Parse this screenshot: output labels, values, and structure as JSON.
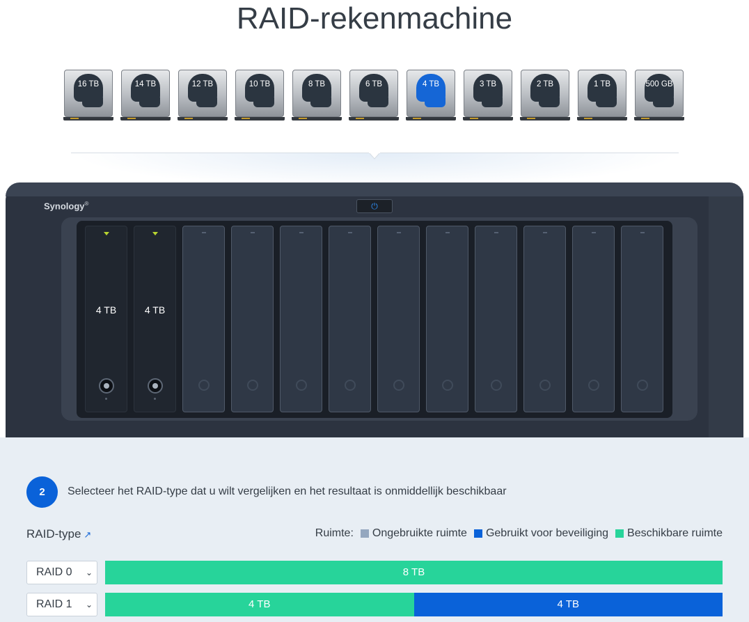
{
  "page": {
    "title": "RAID-rekenmachine"
  },
  "drive_picker": {
    "drives": [
      {
        "label": "16 TB",
        "selected": false
      },
      {
        "label": "14 TB",
        "selected": false
      },
      {
        "label": "12 TB",
        "selected": false
      },
      {
        "label": "10 TB",
        "selected": false
      },
      {
        "label": "8 TB",
        "selected": false
      },
      {
        "label": "6 TB",
        "selected": false
      },
      {
        "label": "4 TB",
        "selected": true
      },
      {
        "label": "3 TB",
        "selected": false
      },
      {
        "label": "2 TB",
        "selected": false
      },
      {
        "label": "1 TB",
        "selected": false
      },
      {
        "label": "500 GB",
        "selected": false
      }
    ]
  },
  "nas": {
    "brand": "Synology",
    "brand_mark": "®",
    "power_icon": "power-icon",
    "slots": [
      {
        "filled": true,
        "capacity": "4 TB"
      },
      {
        "filled": true,
        "capacity": "4 TB"
      },
      {
        "filled": false,
        "capacity": ""
      },
      {
        "filled": false,
        "capacity": ""
      },
      {
        "filled": false,
        "capacity": ""
      },
      {
        "filled": false,
        "capacity": ""
      },
      {
        "filled": false,
        "capacity": ""
      },
      {
        "filled": false,
        "capacity": ""
      },
      {
        "filled": false,
        "capacity": ""
      },
      {
        "filled": false,
        "capacity": ""
      },
      {
        "filled": false,
        "capacity": ""
      },
      {
        "filled": false,
        "capacity": ""
      }
    ]
  },
  "step2": {
    "number": "2",
    "text": "Selecteer het RAID-type dat u wilt vergelijken en het resultaat is onmiddellijk beschikbaar"
  },
  "raid_type": {
    "label": "RAID-type",
    "link_icon": "external-link-icon"
  },
  "legend": {
    "title": "Ruimte:",
    "items": [
      {
        "label": "Ongebruikte ruimte",
        "color": "#94a7bf"
      },
      {
        "label": "Gebruikt voor beveiliging",
        "color": "#0a62d9"
      },
      {
        "label": "Beschikbare ruimte",
        "color": "#27d49a"
      }
    ]
  },
  "raid_rows": [
    {
      "selected": "RAID 0",
      "segments": [
        {
          "label": "8 TB",
          "kind": "available",
          "share": 1.0
        }
      ]
    },
    {
      "selected": "RAID 1",
      "segments": [
        {
          "label": "4 TB",
          "kind": "available",
          "share": 0.5
        },
        {
          "label": "4 TB",
          "kind": "protection",
          "share": 0.5
        }
      ]
    }
  ],
  "colors": {
    "available": "#27d49a",
    "protection": "#0a62d9",
    "unused": "#94a7bf",
    "selected_drive": "#1566d6"
  }
}
